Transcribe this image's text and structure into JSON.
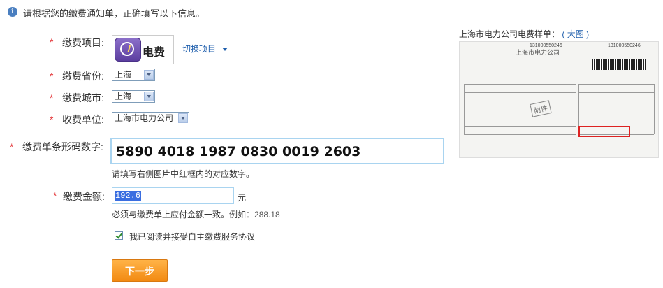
{
  "notice": "请根据您的缴费通知单，正确填写以下信息。",
  "fields": {
    "item_label": "缴费项目:",
    "item_value": "电费",
    "switch_item": "切换项目",
    "province_label": "缴费省份:",
    "province_value": "上海",
    "city_label": "缴费城市:",
    "city_value": "上海",
    "unit_label": "收费单位:",
    "unit_value": "上海市电力公司",
    "barcode_label": "缴费单条形码数字:",
    "barcode_value": "5890 4018 1987 0830 0019 2603",
    "barcode_hint": "请填写右侧图片中红框内的对应数字。",
    "amount_label": "缴费金额:",
    "amount_value": "192.6",
    "amount_unit": "元",
    "amount_hint": "必须与缴费单上应付金额一致。例如：",
    "amount_example": "288.18",
    "agreement": "我已阅读并接受自主缴费服务协议",
    "next_button": "下一步"
  },
  "sample": {
    "title": "上海市电力公司电费样单：",
    "link_open": "(",
    "link": "大图",
    "link_close": ")",
    "stamp": "附件",
    "number_left": "131000550246",
    "number_right": "131000550246",
    "doc_title": "上海市电力公司"
  },
  "colors": {
    "required": "#e4393c",
    "link": "#1f5fad",
    "button": "#f28a12",
    "input_border": "#a9d4f0"
  }
}
